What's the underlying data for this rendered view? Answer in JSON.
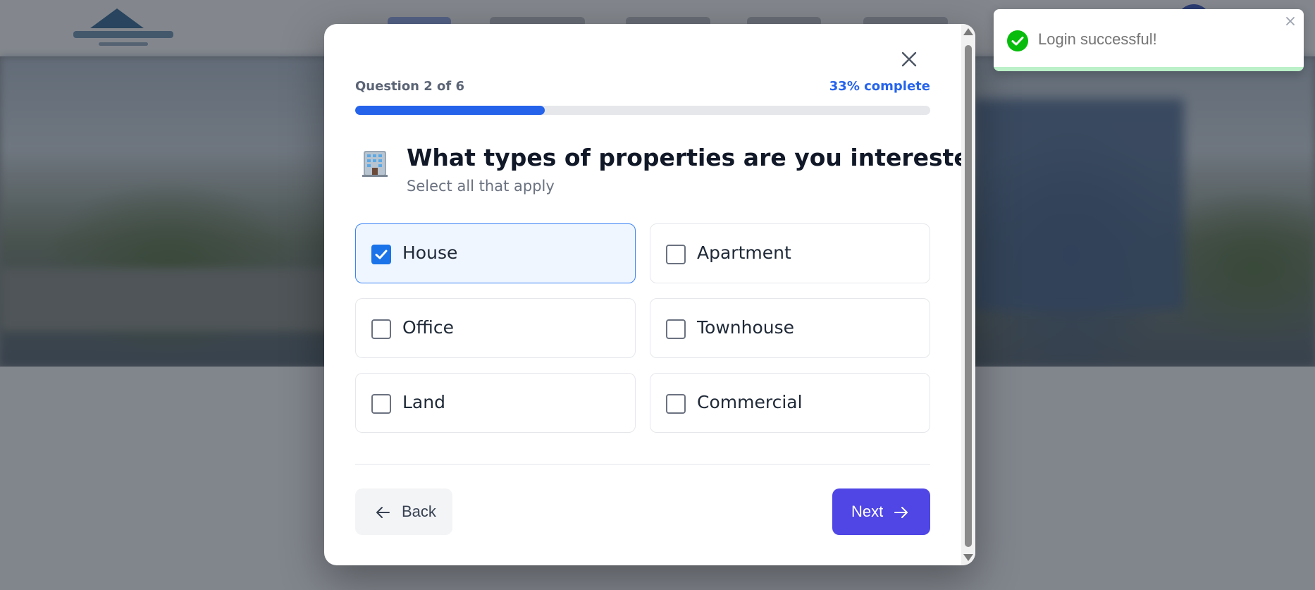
{
  "toast": {
    "message": "Login successful!",
    "icon": "check-circle-icon",
    "color": "#07bc0c",
    "progress_remaining": 1.0
  },
  "modal": {
    "progress": {
      "label": "Question 2 of 6",
      "percent_label": "33% complete",
      "fraction": 0.33,
      "color": "#2563eb"
    },
    "question": {
      "icon": "office-building-emoji",
      "title": "What types of properties are you interested in?",
      "subtitle": "Select all that apply"
    },
    "options": [
      {
        "label": "House",
        "checked": true
      },
      {
        "label": "Apartment",
        "checked": false
      },
      {
        "label": "Office",
        "checked": false
      },
      {
        "label": "Townhouse",
        "checked": false
      },
      {
        "label": "Land",
        "checked": false
      },
      {
        "label": "Commercial",
        "checked": false
      }
    ],
    "back_label": "Back",
    "next_label": "Next",
    "accent_color": "#4f46e5"
  }
}
